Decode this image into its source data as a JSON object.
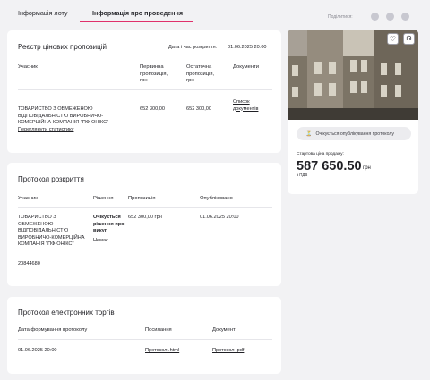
{
  "tabs": [
    {
      "label": "Інформація лоту",
      "active": false
    },
    {
      "label": "Інформація про проведення",
      "active": true
    }
  ],
  "share": {
    "label": "Поділитися:",
    "icons": [
      "viber-icon",
      "telegram-icon",
      "link-icon"
    ]
  },
  "registry": {
    "title": "Реєстр цінових пропозицій",
    "opening_label": "Дата і час розкриття:",
    "opening_value": "01.06.2025 20:00",
    "headers": [
      "Учасник",
      "Первинна пропозиція, грн",
      "Остаточна пропозиція, грн",
      "Документи"
    ],
    "row": {
      "participant": "ТОВАРИСТВО З ОБМЕЖЕНОЮ ВІДПОВІДАЛЬНІСТЮ ВИРОБНИЧО-КОМЕРЦІЙНА КОМПАНІЯ \"ПФ-ОНІКС\"",
      "stats_link": "Переглянути статистику",
      "initial": "652 300,00",
      "final": "652 300,00",
      "docs": "Список документів"
    }
  },
  "opening": {
    "title": "Протокол розкриття",
    "headers": [
      "Учасник",
      "Рішення",
      "Пропозиція",
      "Опубліковано"
    ],
    "row": {
      "participant": "ТОВАРИСТВО З ОБМЕЖЕНОЮ ВІДПОВІДАЛЬНІСТЮ ВИРОБНИЧО-КОМЕРЦІЙНА КОМПАНІЯ \"ПФ-ОНІКС\"",
      "code": "20844680",
      "decision": "Очікується рішення про викуп",
      "decision_sub": "Немає",
      "offer": "652 300,00 грн",
      "published": "01.06.2025 20:00"
    }
  },
  "auction": {
    "title": "Протокол електронних торгів",
    "headers": [
      "Дата формування протоколу",
      "Посилання",
      "Документ"
    ],
    "row": {
      "date": "01.06.2025 20:00",
      "link": "Протокол .html",
      "doc": "Протокол .pdf"
    }
  },
  "side": {
    "status_pill": "Очікується опублікування протоколу",
    "start_price_label": "Стартова ціна продажу:",
    "price": "587 650.50",
    "currency": "грн",
    "vat": "з ПДВ",
    "colors": {
      "accent": "#e0316b",
      "photo_wall": "#8a8172"
    }
  }
}
